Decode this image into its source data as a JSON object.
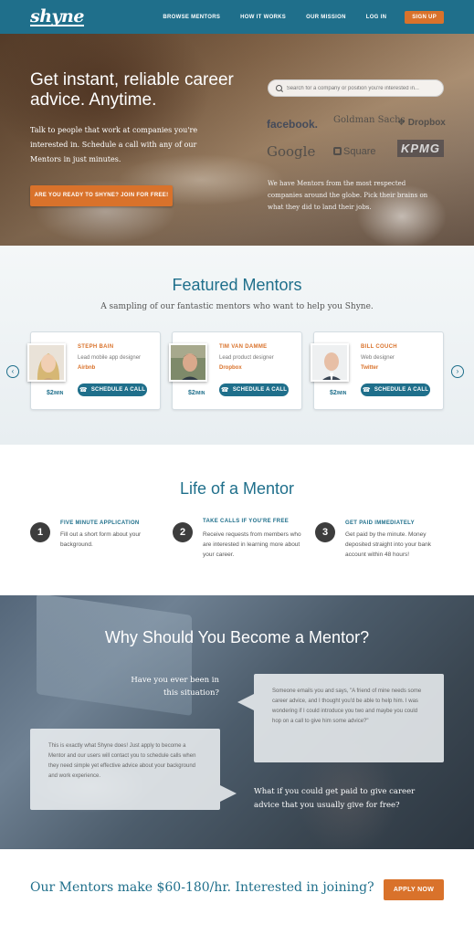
{
  "nav": {
    "logo": "shyne",
    "links": [
      "BROWSE MENTORS",
      "HOW IT WORKS",
      "OUR MISSION",
      "LOG IN"
    ],
    "signup": "SIGN UP"
  },
  "hero": {
    "title": "Get instant, reliable career advice. Anytime.",
    "text": "Talk to people that work at companies you're interested in. Schedule a call with any of our Mentors in just minutes.",
    "cta": "ARE YOU READY TO SHYNE? JOIN FOR FREE!",
    "search_placeholder": "Search for a company or position you're interested in...",
    "companies": [
      "facebook.",
      "Goldman Sachs",
      "Dropbox",
      "Google",
      "Square",
      "KPMG"
    ],
    "sub": "We have Mentors from the most respected companies around the globe. Pick their brains on what they did to land their jobs."
  },
  "featured": {
    "title": "Featured Mentors",
    "subtitle": "A sampling of our fantastic mentors who want to help you Shyne.",
    "call_label": "SCHEDULE A CALL",
    "price_unit": "/MIN",
    "mentors": [
      {
        "name": "STEPH BAIN",
        "role": "Lead mobile app designer",
        "company": "Airbnb",
        "price": "$2"
      },
      {
        "name": "TIM VAN DAMME",
        "role": "Lead product designer",
        "company": "Dropbox",
        "price": "$2"
      },
      {
        "name": "BILL COUCH",
        "role": "Web designer",
        "company": "Twitter",
        "price": "$2"
      }
    ],
    "prev_icon": "‹",
    "next_icon": "›"
  },
  "life": {
    "title": "Life of a Mentor",
    "steps": [
      {
        "num": "1",
        "title": "FIVE MINUTE APPLICATION",
        "text": "Fill out a short form about your background."
      },
      {
        "num": "2",
        "title": "TAKE CALLS IF YOU'RE FREE",
        "text": "Receive requests from members who are interested in learning more about your career."
      },
      {
        "num": "3",
        "title": "GET PAID IMMEDIATELY",
        "text": "Get paid by the minute. Money deposited straight into your bank account within 48 hours!"
      }
    ]
  },
  "why": {
    "title": "Why Should You Become a Mentor?",
    "question1": "Have you ever been in this situation?",
    "bubble_right": "Someone emails you and says, \"A friend of mine needs some career advice, and I thought you'd be able to help him. I was wondering if I could introduce you two and maybe you could hop on a call to give him some advice?\"",
    "bubble_left": "This is exactly what Shyne does! Just apply to become a Mentor and our users will contact you to schedule calls when they need simple yet effective advice about your background and work experience.",
    "question2": "What if you could get paid to give career advice that you usually give for free?"
  },
  "bottom": {
    "text": "Our Mentors make $60-180/hr. Interested in joining?",
    "apply": "APPLY NOW"
  },
  "colors": {
    "brand": "#1f6f8b",
    "accent": "#d9722b"
  }
}
